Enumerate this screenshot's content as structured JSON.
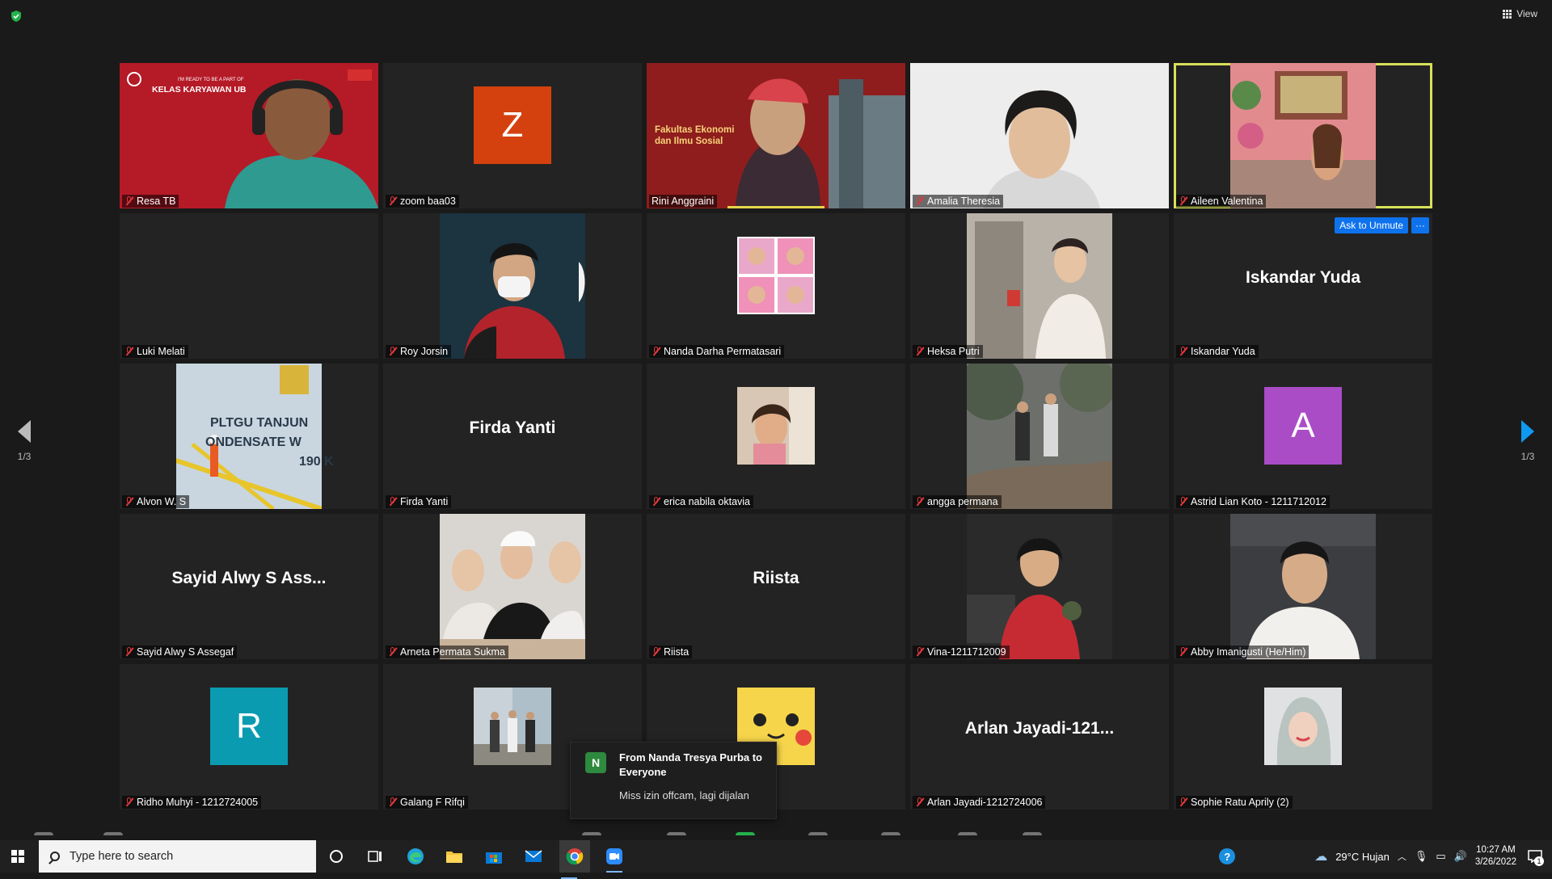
{
  "app": {
    "view_label": "View",
    "accent_color": "#0e72ed",
    "active_speaker_color": "#d7e05a"
  },
  "gallery": {
    "tiles": [
      {
        "name": "Resa TB",
        "kind": "video",
        "banner": "I'M READY TO BE A PART OF",
        "banner2": "KELAS KARYAWAN UB"
      },
      {
        "name": "zoom baa03",
        "kind": "avatar",
        "letter": "Z",
        "color": "#d4410f"
      },
      {
        "name": "Rini Anggraini",
        "kind": "video",
        "banner": "Fakultas Ekonomi",
        "banner2": "dan Ilmu Sosial"
      },
      {
        "name": "Amalia Theresia",
        "kind": "video"
      },
      {
        "name": "Aileen Valentina",
        "kind": "photo-active"
      },
      {
        "name": "Luki Melati",
        "kind": "blank"
      },
      {
        "name": "Roy Jorsin",
        "kind": "portrait"
      },
      {
        "name": "Nanda Darha Permatasari",
        "kind": "thumb"
      },
      {
        "name": "Heksa Putri",
        "kind": "portrait"
      },
      {
        "name": "Iskandar Yuda",
        "kind": "centername",
        "display": "Iskandar Yuda"
      },
      {
        "name": "Alvon W. S",
        "kind": "portrait",
        "sign1": "PLTGU TANJUN",
        "sign2": "ONDENSATE W",
        "sign3": "190 K"
      },
      {
        "name": "Firda Yanti",
        "kind": "centername",
        "display": "Firda Yanti"
      },
      {
        "name": "erica nabila oktavia",
        "kind": "thumb"
      },
      {
        "name": "angga permana",
        "kind": "portrait"
      },
      {
        "name": "Astrid Lian Koto - 1211712012",
        "kind": "avatar",
        "letter": "A",
        "color": "#a94cc6"
      },
      {
        "name": "Sayid Alwy S Assegaf",
        "kind": "centername",
        "display": "Sayid Alwy S Ass..."
      },
      {
        "name": "Arneta Permata Sukma",
        "kind": "portrait"
      },
      {
        "name": "Riista",
        "kind": "centername",
        "display": "Riista"
      },
      {
        "name": "Vina-1211712009",
        "kind": "portrait"
      },
      {
        "name": "Abby Imanigusti (He/Him)",
        "kind": "portrait"
      },
      {
        "name": "Ridho Muhyi - 1212724005",
        "kind": "avatar",
        "letter": "R",
        "color": "#0b9bb1"
      },
      {
        "name": "Galang F Rifqi",
        "kind": "thumb"
      },
      {
        "name": "",
        "kind": "thumb"
      },
      {
        "name": "Arlan Jayadi-1212724006",
        "kind": "centername",
        "display": "Arlan Jayadi-121..."
      },
      {
        "name": "Sophie Ratu Aprily (2)",
        "kind": "thumb"
      }
    ],
    "ask_unmute_label": "Ask to Unmute",
    "more_label": "···"
  },
  "pager": {
    "left_label": "1/3",
    "right_label": "1/3"
  },
  "chat_toast": {
    "initial": "N",
    "from": "From Nanda Tresya Purba to Everyone",
    "message": "Miss izin offcam, lagi dijalan"
  },
  "taskbar": {
    "search_placeholder": "Type here to search",
    "weather": "29°C  Hujan",
    "time": "10:27 AM",
    "date": "3/26/2022",
    "notification_count": "1"
  }
}
